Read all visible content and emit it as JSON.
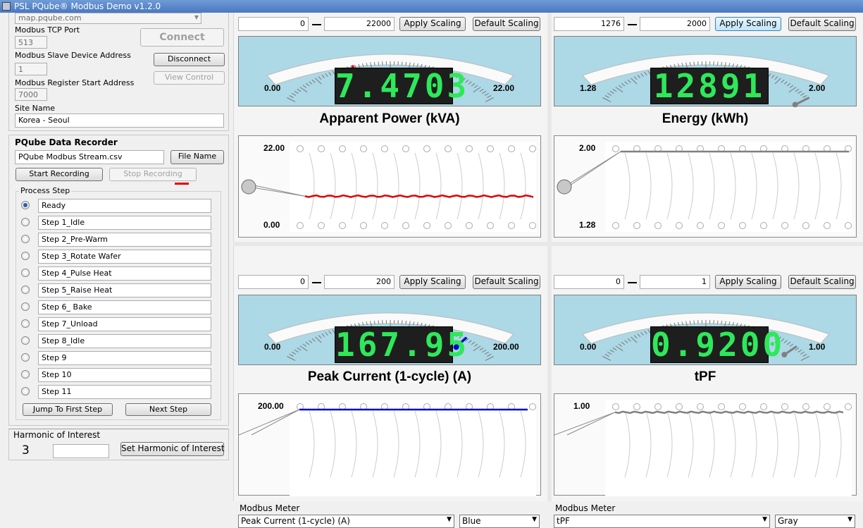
{
  "app": {
    "title": "PSL PQube® Modbus Demo v1.2.0"
  },
  "connection": {
    "host_value": "map.pqube.com",
    "tcp_port_label": "Modbus TCP Port",
    "tcp_port_value": "513",
    "slave_label": "Modbus Slave Device Address",
    "slave_value": "1",
    "register_label": "Modbus Register Start Address",
    "register_value": "7000",
    "site_label": "Site Name",
    "site_value": "Korea - Seoul",
    "connect_label": "Connect",
    "disconnect_label": "Disconnect",
    "view_control_label": "View Control"
  },
  "recorder": {
    "title": "PQube Data Recorder",
    "file_value": "PQube Modbus Stream.csv",
    "file_name_label": "File Name",
    "start_label": "Start Recording",
    "stop_label": "Stop Recording"
  },
  "process": {
    "title": "Process Step",
    "steps": [
      "Ready",
      "Step 1_Idle",
      "Step 2_Pre-Warm",
      "Step 3_Rotate Wafer",
      "Step 4_Pulse Heat",
      "Step 5_Raise Heat",
      "Step 6_ Bake",
      "Step 7_Unload",
      "Step 8_Idle",
      "Step 9",
      "Step 10",
      "Step 11"
    ],
    "selected": 0,
    "jump_label": "Jump To First Step",
    "next_label": "Next Step"
  },
  "harmonic": {
    "title": "Harmonic of Interest",
    "value": "3",
    "input_value": "",
    "set_label": "Set Harmonic of Interest"
  },
  "scaling": {
    "apply_label": "Apply Scaling",
    "default_label": "Default Scaling"
  },
  "meters": [
    {
      "min_value": "0",
      "max_value": "22000",
      "gauge_min": "0.00",
      "gauge_max": "22.00",
      "reading": "7.4703",
      "title": "Apparent Power (kVA)",
      "color": "#e00000",
      "needle_frac": 0.34,
      "chart_max": "22.00",
      "chart_min": "0.00",
      "trend_frac": 0.34,
      "apply_highlight": false
    },
    {
      "min_value": "1276",
      "max_value": "2000",
      "gauge_min": "1.28",
      "gauge_max": "2.00",
      "reading": "12891",
      "title": "Energy (kWh)",
      "color": "#808080",
      "needle_frac": 1.0,
      "chart_max": "2.00",
      "chart_min": "1.28",
      "trend_frac": 1.0,
      "apply_highlight": true
    },
    {
      "meter_label": "Modbus Meter",
      "param_value": "Peak Current (1-cycle) (A)",
      "color_value": "Blue",
      "min_value": "0",
      "max_value": "200",
      "gauge_min": "0.00",
      "gauge_max": "200.00",
      "reading": "167.95",
      "title": "Peak Current (1-cycle) (A)",
      "color": "#0000d0",
      "needle_frac": 0.84,
      "chart_max": "200.00",
      "trend_frac": 1.0,
      "apply_highlight": false
    },
    {
      "meter_label": "Modbus Meter",
      "param_value": "tPF",
      "color_value": "Gray",
      "min_value": "0",
      "max_value": "1",
      "gauge_min": "0.00",
      "gauge_max": "1.00",
      "reading": "0.9200",
      "title": "tPF",
      "color": "#808080",
      "needle_frac": 0.92,
      "chart_max": "1.00",
      "trend_frac": 0.96,
      "apply_highlight": false
    }
  ]
}
